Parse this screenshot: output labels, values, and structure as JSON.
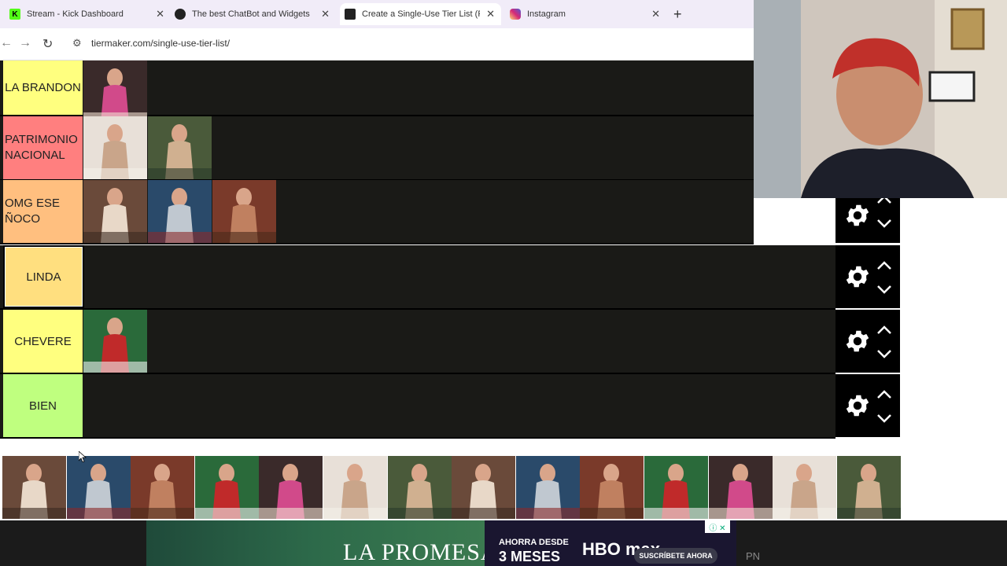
{
  "browser": {
    "tabs": [
      {
        "title": "Stream - Kick Dashboard",
        "icon": "kick-icon",
        "color": "#53fc18",
        "letter": "K"
      },
      {
        "title": "The best ChatBot and Widgets",
        "icon": "botrix-icon",
        "color": "#222222",
        "letter": ""
      },
      {
        "title": "Create a Single-Use Tier List (Pr",
        "icon": "tiermaker-icon",
        "color": "#222222",
        "letter": ""
      },
      {
        "title": "Instagram",
        "icon": "instagram-icon",
        "color": "#d6249f",
        "letter": ""
      }
    ],
    "url": "tiermaker.com/single-use-tier-list/"
  },
  "tiers": [
    {
      "label": "LA BRANDON",
      "color": "#ffff7f",
      "images": 1
    },
    {
      "label": "PATRIMONIO NACIONAL",
      "color": "#ff7f7f",
      "images": 2
    },
    {
      "label": "OMG ESE ÑOCO",
      "color": "#ffbf7f",
      "images": 3
    },
    {
      "label": "LINDA",
      "color": "#ffdf7f",
      "images": 0
    },
    {
      "label": "CHEVERE",
      "color": "#ffff7f",
      "images": 1
    },
    {
      "label": "BIEN",
      "color": "#bfff7f",
      "images": 0
    }
  ],
  "pool_count": 14,
  "ad": {
    "promesa": "LA PROMESA",
    "hbo_line1": "AHORRA DESDE",
    "hbo_line2": "3 MESES",
    "hbo_logo": "HBO max",
    "cta": "SUSCRÍBETE AHORA",
    "pn": "PN"
  }
}
